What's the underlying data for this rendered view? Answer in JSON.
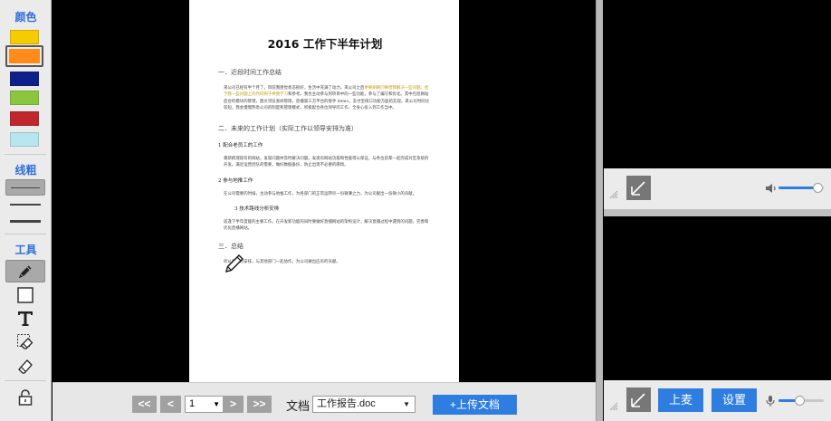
{
  "toolbar": {
    "color_heading": "颜色",
    "colors": [
      {
        "name": "yellow",
        "hex": "#f5cc00"
      },
      {
        "name": "orange",
        "hex": "#ff8c1a"
      },
      {
        "name": "navy",
        "hex": "#10208a"
      },
      {
        "name": "green",
        "hex": "#8cc63f"
      },
      {
        "name": "red",
        "hex": "#c0282d"
      },
      {
        "name": "light-blue",
        "hex": "#b8e6ee"
      }
    ],
    "selected_color": "orange",
    "line_heading": "线粗",
    "line_widths": [
      "thin",
      "medium",
      "thick"
    ],
    "selected_line": "thin",
    "tool_heading": "工具",
    "tools": [
      "pen-icon",
      "rectangle-icon",
      "text-icon",
      "eraser-region-icon",
      "eraser-icon",
      "lock-icon"
    ],
    "selected_tool": "pen-icon"
  },
  "document": {
    "title": "2016 工作下半年计划",
    "section1": "一．近段时间工作总结",
    "para1_a": "来公司已经有半个月了，目前我感觉状态很好，生活中充满了动力。来公司之后",
    "para1_hl": "更要刷刷问事营我解决一些问题，给予我一些问题上的代码例子供我学习",
    "para1_b": "和参考。我也主动参与到项目中的一些功能，参与了编写和优化。其中包括网站后台的模块的管理，图文浏览查阅管理，直播第三方平台的接手 demo，支付宝接口功能方面的实现。来公司时间比较短，我会慢慢熟悉公司的制度和管理模式，积极配合各位领导的工作，全身心投入到工作当中。",
    "section2": "二．未来的工作计划（实际工作以领导安排为准）",
    "sub1": "1 配合老员工的工作",
    "para2": "重新梳理现有的网站，发现问题并及时解决问题。发现有网站功能和性能得以保证，与各位前辈一起完成对区系统的开发。满足运营团队的需要，做好数据备份，防止出现不必要的麻烦。",
    "sub2": "2 参与地推工作",
    "para3": "在公司需要的时候，主动参与地推工作，为各部门的正常运转尽一份微薄之力，为公司献出一份微小的贡献。",
    "sub3": "3 技术路线分析安排",
    "para4": "适逢下半年度能的主要工作。在开发新功能的同时要做好直播网站的架构设计，解决直播过程中遇到的问题，完善和优化直播网站。",
    "section3": "三．总结",
    "para5": "听从领导的安排，与其他部门一起协作，为公司做出应有的贡献。"
  },
  "bottom_bar": {
    "first_label": "<<",
    "prev_label": "<",
    "page_value": "1",
    "next_label": ">",
    "last_label": ">>",
    "doc_label": "文档",
    "doc_value": "工作报告.doc",
    "upload_label": "+上传文档"
  },
  "right_panel": {
    "volume_level": 0.85,
    "mic_level": 0.45,
    "raise_hand_label": "上麦",
    "settings_label": "设置"
  }
}
